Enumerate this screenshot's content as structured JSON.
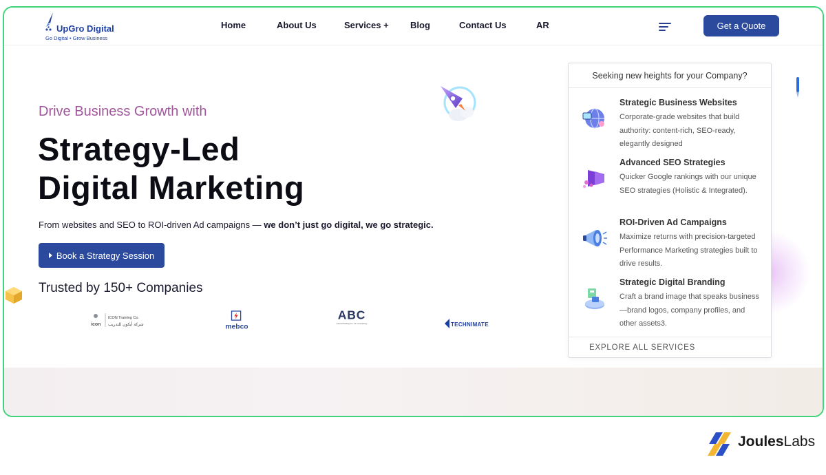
{
  "header": {
    "logo_name": "UpGro Digital",
    "logo_tagline": "Go Digital • Grow Business",
    "nav": [
      "Home",
      "About Us",
      "Services +",
      "Blog",
      "Contact Us",
      "AR"
    ],
    "quote_label": "Get a Quote"
  },
  "hero": {
    "eyebrow": "Drive Business Growth with",
    "headline_line1": "Strategy-Led",
    "headline_line2": "Digital Marketing",
    "lead_normal": "From websites and SEO to ROI-driven Ad campaigns — ",
    "lead_bold": "we don’t just go digital, we go strategic.",
    "cta_label": "Book a Strategy Session",
    "trusted_label": "Trusted by 150+ Companies"
  },
  "clients": {
    "icon_name": "ICON Training Co.",
    "icon_arabic": "شركة أيكون للتدريب",
    "icon_word": "icon",
    "mebco": "mebco",
    "abc": "ABC",
    "abc_sub": "Adel Al Badrag Co. for Contracting",
    "technimate": "TECHNIMATE"
  },
  "services_panel": {
    "heading": "Seeking new heights for your Company?",
    "items": [
      {
        "title": "Strategic Business Websites",
        "desc": "Corporate-grade websites that build authority: content-rich, SEO-ready, elegantly designed",
        "icon": "website-icon"
      },
      {
        "title": "Advanced SEO Strategies",
        "desc": "Quicker Google rankings with our unique SEO strategies (Holistic & Integrated).",
        "icon": "seo-icon"
      },
      {
        "title": "ROI-Driven Ad Campaigns",
        "desc": "Maximize returns with precision-targeted Performance Marketing strategies built to drive results.",
        "icon": "megaphone-icon"
      },
      {
        "title": "Strategic Digital Branding",
        "desc": "Craft a brand image that speaks business—brand logos, company profiles, and other assets3.",
        "icon": "branding-icon"
      }
    ],
    "footer": "EXPLORE ALL SERVICES"
  },
  "watermark": {
    "bold": "Joules",
    "normal": "Labs"
  },
  "colors": {
    "brand_blue": "#2b4a9e",
    "eyebrow_purple": "#a0559a",
    "frame_green": "#3fd47a"
  }
}
